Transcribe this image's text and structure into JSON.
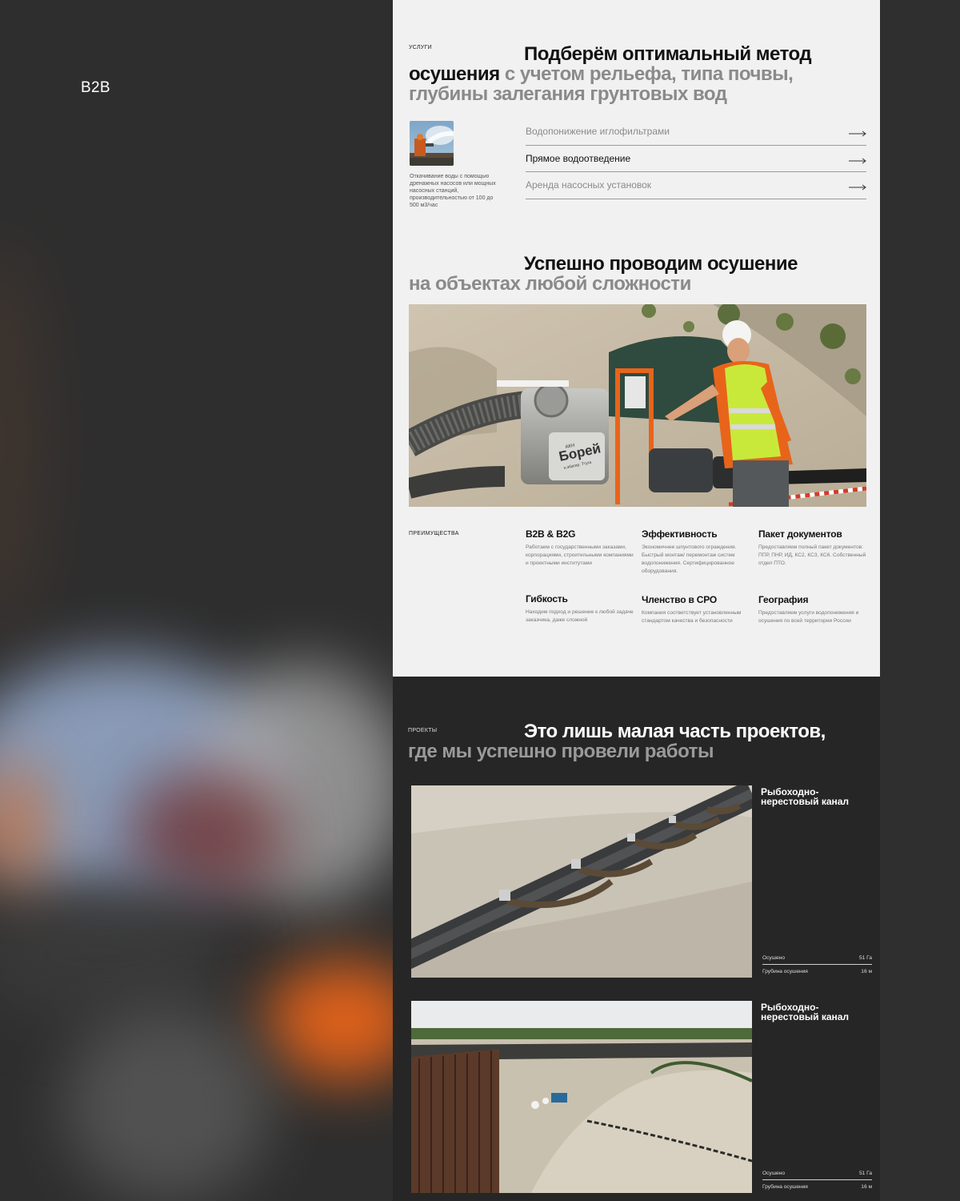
{
  "brand": "B2B",
  "services": {
    "tag": "услуги",
    "title_dark_1": "Подберём оптимальный метод осушения",
    "title_grey": " с учетом рельефа, типа почвы, глубины залегания грунтовых вод",
    "description": "Откачивание воды с помощью дренажных насосов или мощных насосных станций, производительностью от 100 до 500 м3/час",
    "items": [
      {
        "label": "Водопонижение иглофильтрами",
        "active": false
      },
      {
        "label": "Прямое водоотведение",
        "active": true
      },
      {
        "label": "Аренда насосных установок",
        "active": false
      }
    ]
  },
  "success": {
    "title_dark": "Успешно проводим осушение",
    "title_grey": "на объектах любой сложности",
    "pump_brand": "Борей",
    "pump_small": "АКН",
    "pump_sub": "н.эбатер. Ттуга"
  },
  "advantages": {
    "tag": "преимущества",
    "items": [
      {
        "title": "B2B & B2G",
        "text": "Работаем с государственными заказами, корпорациями, строительными компаниями и проектными институтами"
      },
      {
        "title": "Эффективность",
        "text": "Экономичнее шпунтового ограждения. Быстрый монтаж/ перемонтаж систем водопонижения. Сертифицированное оборудования."
      },
      {
        "title": "Пакет документов",
        "text": "Предоставляем полный пакет документов: ППР, ПНР, ИД, КС2, КС3, КС6. Собственный отдел ПТО."
      },
      {
        "title": "Гибкость",
        "text": "Находим подход и решение к любой задаче заказчика, даже сложной"
      },
      {
        "title": "Членство в СРО",
        "text": "Компания соответствует установленным стандартом качества и безопасности"
      },
      {
        "title": "География",
        "text": "Предоставляем услуги водопонижения и осушения по всей территории России"
      }
    ]
  },
  "projects": {
    "tag": "проекты",
    "title_dark": "Это лишь малая часть проектов,",
    "title_grey": "где мы успешно провели работы",
    "cards": [
      {
        "name": "Рыбоходно-нерестовый канал",
        "stats": [
          {
            "label": "Осушено",
            "value": "51 Га"
          },
          {
            "label": "Грубина осушения",
            "value": "16 м"
          }
        ]
      },
      {
        "name": "Рыбоходно-нерестовый канал",
        "stats": [
          {
            "label": "Осушено",
            "value": "51 Га"
          },
          {
            "label": "Грубина осушения",
            "value": "16 м"
          }
        ]
      }
    ]
  },
  "colors": {
    "page_bg": "#f1f1f1",
    "backdrop": "#2f2f2f",
    "dark_section": "#262626",
    "accent_orange": "#e8641a",
    "vest_yellow": "#c9e93a"
  }
}
